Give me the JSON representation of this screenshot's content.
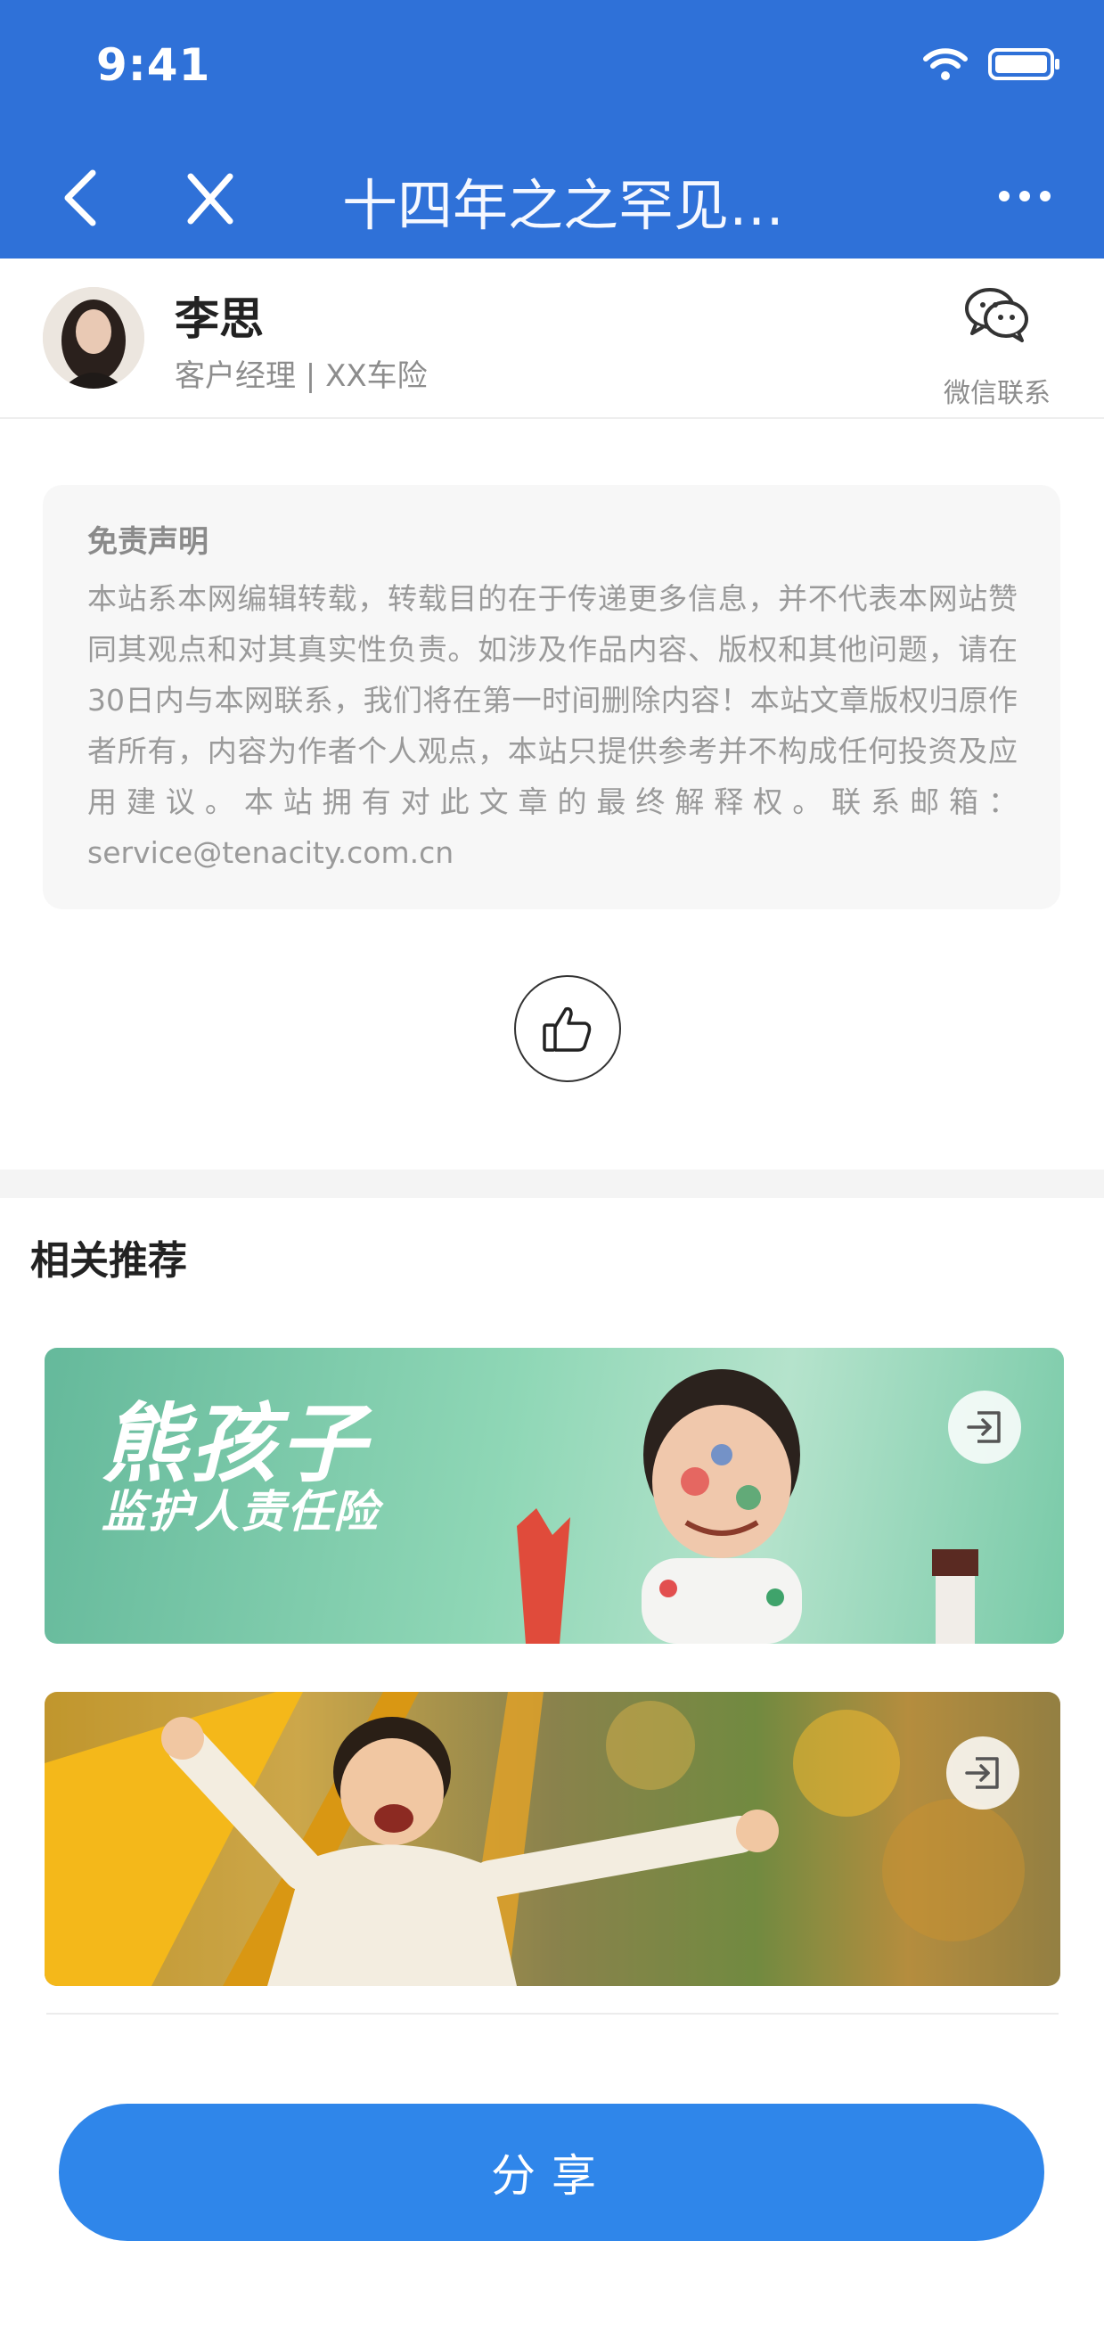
{
  "status": {
    "time": "9:41"
  },
  "nav": {
    "title": "十四年之之罕见…"
  },
  "author": {
    "name": "李思",
    "role": "客户经理 | XX车险",
    "wechat_label": "微信联系"
  },
  "disclaimer": {
    "heading": "免责声明",
    "body": "本站系本网编辑转载，转载目的在于传递更多信息，并不代表本网站赞同其观点和对其真实性负责。如涉及作品内容、版权和其他问题，请在30日内与本网联系，我们将在第一时间删除内容！本站文章版权归原作者所有，内容为作者个人观点，本站只提供参考并不构成任何投资及应用建议。本站拥有对此文章的最终解释权。联系邮箱：service@tenacity.com.cn"
  },
  "recommend": {
    "title": "相关推荐",
    "banners": [
      {
        "headline": "熊孩子",
        "subline": "监护人责任险"
      },
      {
        "headline": "",
        "subline": ""
      }
    ]
  },
  "share": {
    "label": "分享"
  },
  "colors": {
    "header": "#2f71d8",
    "share_button": "#2f86ea",
    "banner1": "#8fd7b6"
  },
  "icons": [
    "wifi-icon",
    "battery-icon",
    "back-icon",
    "close-icon",
    "more-icon",
    "wechat-icon",
    "thumb-up-icon",
    "external-link-icon"
  ]
}
